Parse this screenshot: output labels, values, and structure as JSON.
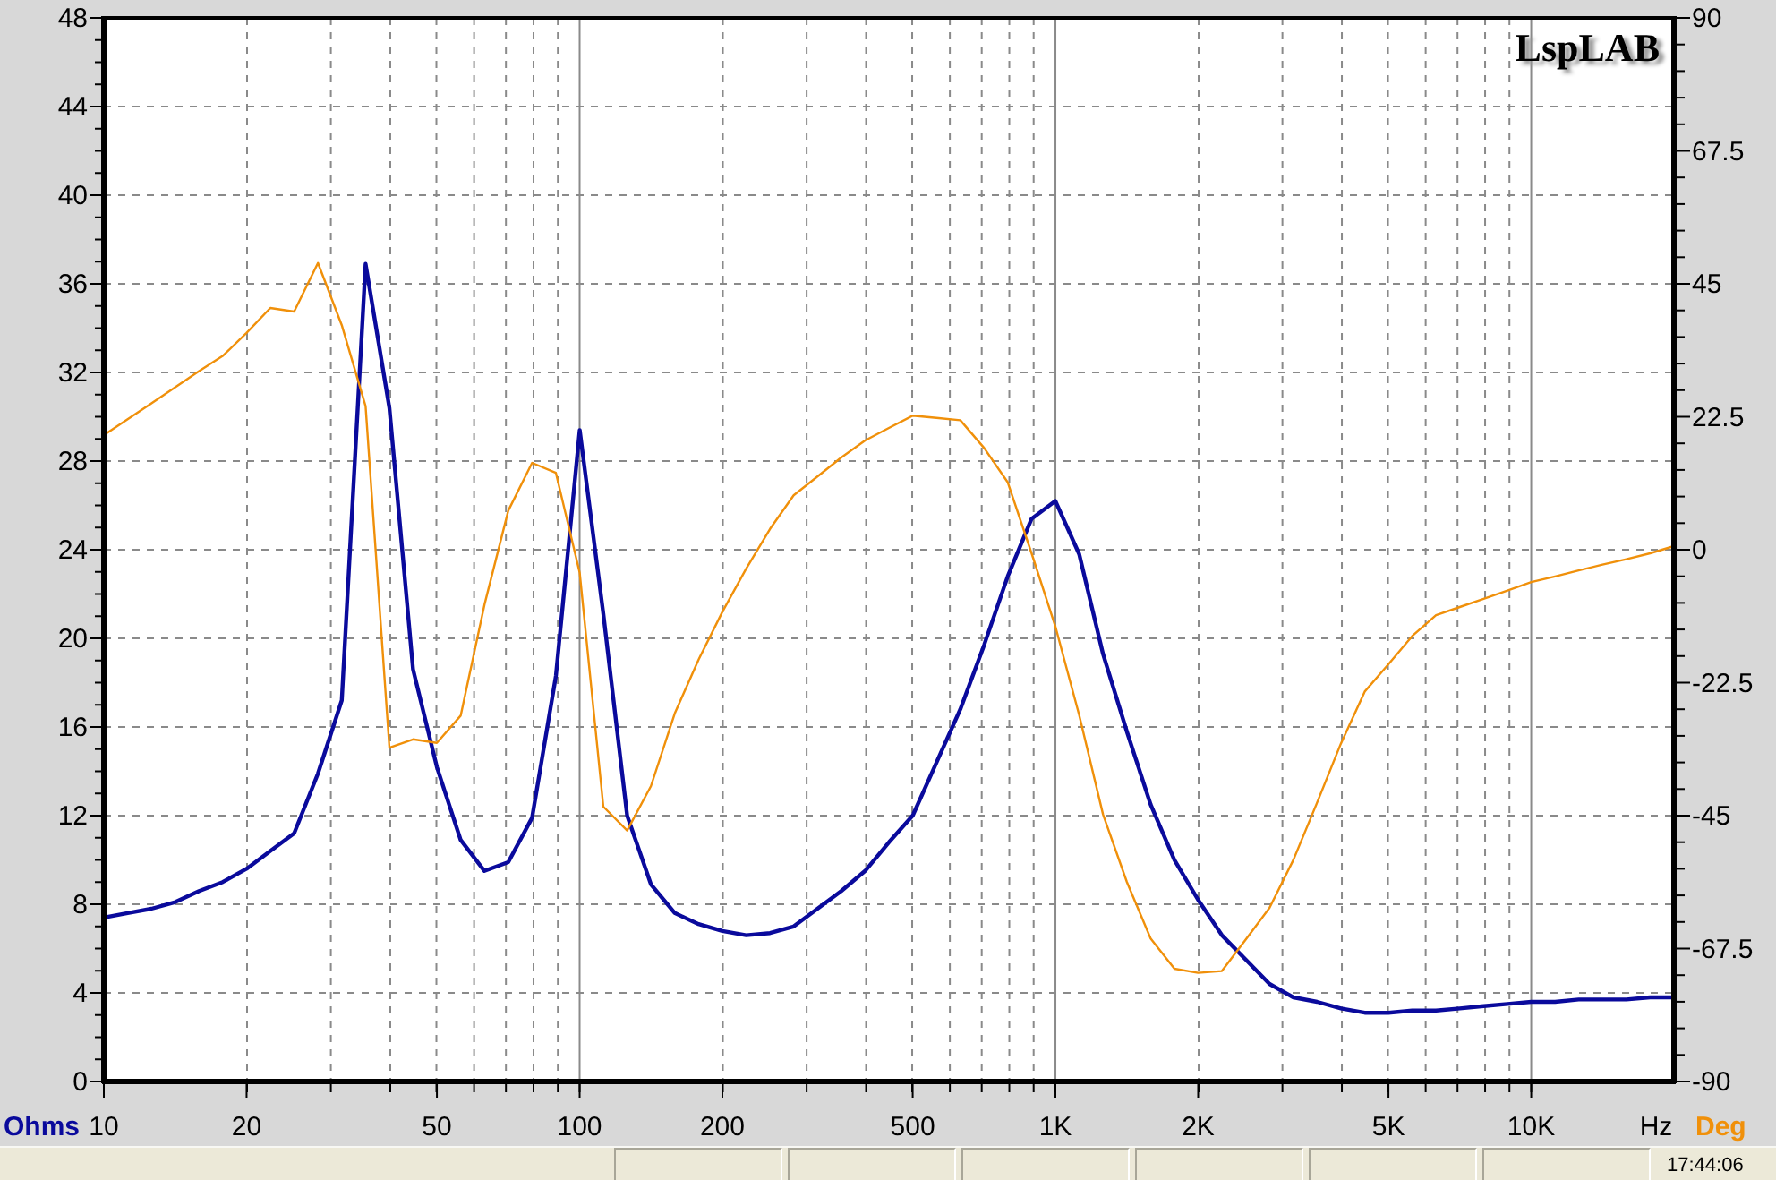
{
  "chart": {
    "logo": "LspLAB",
    "chart_data": {
      "type": "line",
      "xlabel": "Hz",
      "ylabel": "Ohms",
      "y2label": "Deg",
      "grid": true,
      "ylim": [
        0,
        48
      ],
      "y2lim": [
        -90,
        90
      ],
      "categories": [
        "10",
        null,
        null,
        null,
        null,
        null,
        "20",
        null,
        null,
        null,
        null,
        null,
        null,
        null,
        "50",
        null,
        null,
        null,
        null,
        null,
        "100",
        null,
        null,
        null,
        null,
        null,
        "200",
        null,
        null,
        null,
        null,
        null,
        null,
        null,
        "500",
        null,
        null,
        null,
        null,
        null,
        "1K",
        null,
        null,
        null,
        null,
        null,
        "2K",
        null,
        null,
        null,
        null,
        null,
        null,
        null,
        "5K",
        null,
        null,
        null,
        null,
        null,
        "10K",
        null,
        null,
        null,
        null,
        null,
        null
      ],
      "yticks": [
        0,
        4,
        8,
        12,
        16,
        20,
        24,
        28,
        32,
        36,
        40,
        44,
        48
      ],
      "y2ticks": [
        -90,
        -67.5,
        -45,
        -22.5,
        0,
        22.5,
        45,
        67.5,
        90
      ],
      "series": [
        {
          "color": "#0a0a9c",
          "values": [
            7.4,
            7.6,
            7.8,
            8.1,
            8.6,
            9.0,
            9.6,
            10.4,
            11.2,
            13.9,
            17.2,
            36.9,
            30.4,
            18.6,
            14.2,
            10.9,
            9.5,
            9.9,
            11.9,
            18.3,
            29.4,
            21.1,
            12.0,
            8.9,
            7.6,
            7.1,
            6.8,
            6.6,
            6.7,
            7.0,
            7.8,
            8.6,
            9.5,
            10.8,
            12.0,
            14.4,
            16.8,
            19.7,
            22.8,
            25.4,
            26.2,
            23.8,
            19.3,
            15.8,
            12.5,
            10.0,
            8.2,
            6.6,
            5.5,
            4.4,
            3.8,
            3.6,
            3.3,
            3.1,
            3.1,
            3.2,
            3.2,
            3.3,
            3.4,
            3.5,
            3.6,
            3.6,
            3.7,
            3.7,
            3.7,
            3.8,
            3.8
          ]
        },
        {
          "color": "#f0900a",
          "axis": "y2",
          "values": [
            19.4,
            22.1,
            24.8,
            27.5,
            30.2,
            32.8,
            36.7,
            40.9,
            40.3,
            48.5,
            38.0,
            24.3,
            -33.5,
            -32.1,
            -32.7,
            -28.1,
            -9.3,
            6.6,
            14.7,
            13.0,
            -3.9,
            -43.5,
            -47.5,
            -40.0,
            -27.7,
            -18.6,
            -10.5,
            -3.2,
            3.5,
            9.2,
            12.4,
            15.6,
            18.5,
            20.6,
            22.7,
            22.3,
            21.9,
            17.2,
            11.4,
            -0.6,
            -13.0,
            -28.0,
            -44.8,
            -56.2,
            -65.8,
            -70.9,
            -71.6,
            -71.3,
            -66.0,
            -60.6,
            -52.5,
            -42.8,
            -32.8,
            -24.0,
            -19.4,
            -14.6,
            -11.1,
            -9.7,
            -8.3,
            -6.9,
            -5.5,
            -4.5,
            -3.5,
            -2.5,
            -1.6,
            -0.6,
            0.6
          ]
        }
      ]
    }
  },
  "status_bar": {
    "clock": "17:44:06"
  }
}
